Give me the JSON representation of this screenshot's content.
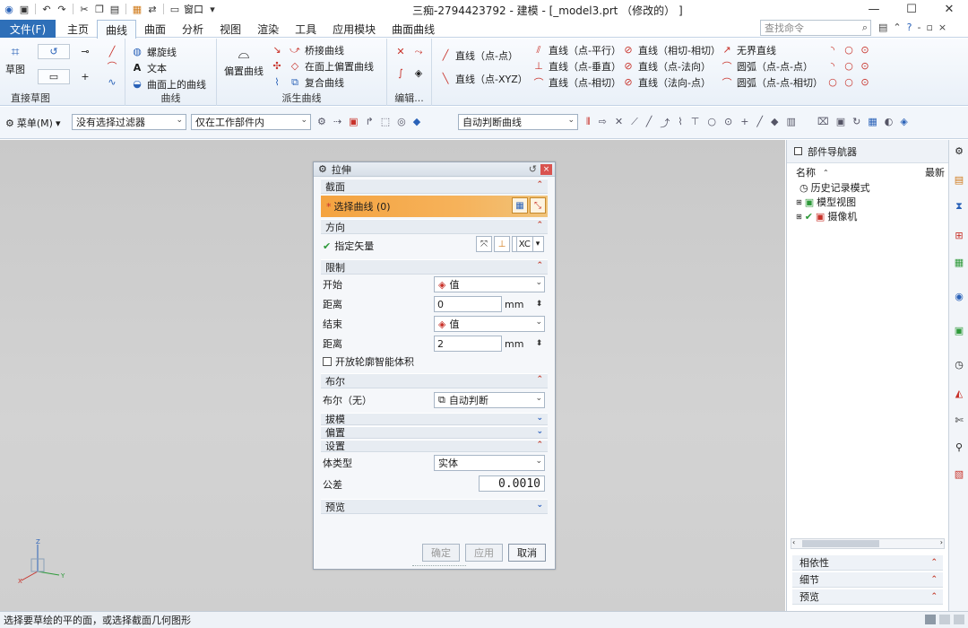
{
  "window": {
    "title": "三痴-2794423792 - 建模 - [_model3.prt （修改的） ]",
    "window_menu": "窗口",
    "controls": [
      "—",
      "☐",
      "✕"
    ]
  },
  "tabs": {
    "file": "文件(F)",
    "items": [
      "主页",
      "曲线",
      "曲面",
      "分析",
      "视图",
      "渲染",
      "工具",
      "应用模块",
      "曲面曲线"
    ],
    "active": "曲线"
  },
  "search": {
    "placeholder": "查找命令"
  },
  "ribbon": {
    "sketch_group": {
      "big": "草图",
      "label": "直接草图"
    },
    "curve_group": {
      "label": "曲线",
      "items": [
        "螺旋线",
        "文本",
        "曲面上的曲线"
      ]
    },
    "derived_group": {
      "label": "派生曲线",
      "big": "偏置曲线",
      "items": [
        "桥接曲线",
        "在面上偏置曲线",
        "复合曲线"
      ]
    },
    "edit_group": {
      "label": "编辑..."
    },
    "lines": [
      "直线（点-点）",
      "直线（点-XYZ）",
      "直线（点-平行）",
      "直线（点-垂直）",
      "直线（点-相切）",
      "直线（相切-相切）",
      "直线（点-法向）",
      "直线（法向-点）",
      "无界直线",
      "圆弧（点-点-点）",
      "圆弧（点-点-相切）"
    ]
  },
  "toolbar2": {
    "menu": "菜单(M)",
    "filter": "没有选择过滤器",
    "scope": "仅在工作部件内",
    "snap": "自动判断曲线"
  },
  "dialog": {
    "title": "拉伸",
    "sections": {
      "section": "截面",
      "direction": "方向",
      "limits": "限制",
      "boolean": "布尔",
      "draft": "拔模",
      "offset": "偏置",
      "settings": "设置",
      "preview": "预览"
    },
    "select_curve": "选择曲线 (0)",
    "specify_vector": "指定矢量",
    "vector_label": "XC",
    "start_label": "开始",
    "start_value": "值",
    "distance_label": "距离",
    "start_distance": "0",
    "end_label": "结束",
    "end_value": "值",
    "end_distance": "2",
    "unit": "mm",
    "open_profile": "开放轮廓智能体积",
    "boolean_label": "布尔（无）",
    "boolean_value": "自动判断",
    "body_type_label": "体类型",
    "body_type_value": "实体",
    "tolerance_label": "公差",
    "tolerance_value": "0.0010",
    "buttons": {
      "ok": "确定",
      "apply": "应用",
      "cancel": "取消"
    }
  },
  "navigator": {
    "title": "部件导航器",
    "col_name": "名称",
    "col_latest": "最新",
    "tree": [
      "历史记录模式",
      "模型视图",
      "摄像机"
    ],
    "sections": [
      "相依性",
      "细节",
      "预览"
    ]
  },
  "status": {
    "message": "选择要草绘的平的面，或选择截面几何图形"
  },
  "colors": {
    "accent": "#2e6fb8",
    "selection": "#f4a340",
    "canvas": "#cccccc"
  }
}
